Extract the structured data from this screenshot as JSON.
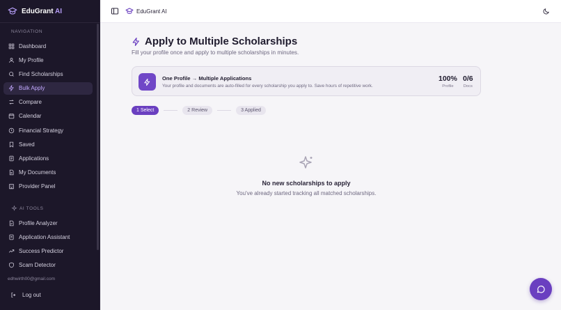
{
  "app": {
    "brand": "EduGrant",
    "brand_ai": "AI",
    "top_brand": "EduGrant AI"
  },
  "sidebar": {
    "nav_label": "NAVIGATION",
    "nav_items": [
      {
        "label": "Dashboard",
        "icon": "grid-icon"
      },
      {
        "label": "My Profile",
        "icon": "user-icon"
      },
      {
        "label": "Find Scholarships",
        "icon": "search-icon"
      },
      {
        "label": "Bulk Apply",
        "icon": "sparkle-icon",
        "active": true
      },
      {
        "label": "Compare",
        "icon": "compare-icon"
      },
      {
        "label": "Calendar",
        "icon": "calendar-icon"
      },
      {
        "label": "Financial Strategy",
        "icon": "clock-icon"
      },
      {
        "label": "Saved",
        "icon": "bookmark-icon"
      },
      {
        "label": "Applications",
        "icon": "document-icon"
      },
      {
        "label": "My Documents",
        "icon": "file-icon"
      },
      {
        "label": "Provider Panel",
        "icon": "building-icon"
      }
    ],
    "tools_label": "AI TOOLS",
    "tool_items": [
      {
        "label": "Profile Analyzer",
        "icon": "profile-analyzer-icon"
      },
      {
        "label": "Application Assistant",
        "icon": "assistant-icon"
      },
      {
        "label": "Success Predictor",
        "icon": "trend-icon"
      },
      {
        "label": "Scam Detector",
        "icon": "shield-icon"
      }
    ],
    "email": "edhwirth00@gmail.com",
    "logout_label": "Log out"
  },
  "main": {
    "title": "Apply to Multiple Scholarships",
    "subtitle": "Fill your profile once and apply to multiple scholarships in minutes.",
    "info": {
      "title": "One Profile → Multiple Applications",
      "desc": "Your profile and documents are auto-filled for every scholarship you apply to. Save hours of repetitive work.",
      "profile_value": "100%",
      "profile_label": "Profile",
      "docs_value": "0/6",
      "docs_label": "Docs"
    },
    "steps": [
      "1 Select",
      "2 Review",
      "3 Applied"
    ],
    "empty_title": "No new scholarships to apply",
    "empty_desc": "You've already started tracking all matched scholarships."
  },
  "colors": {
    "accent": "#6a3fc0",
    "sidebar_bg": "#1c1729",
    "active_text": "#c2a9ff"
  }
}
